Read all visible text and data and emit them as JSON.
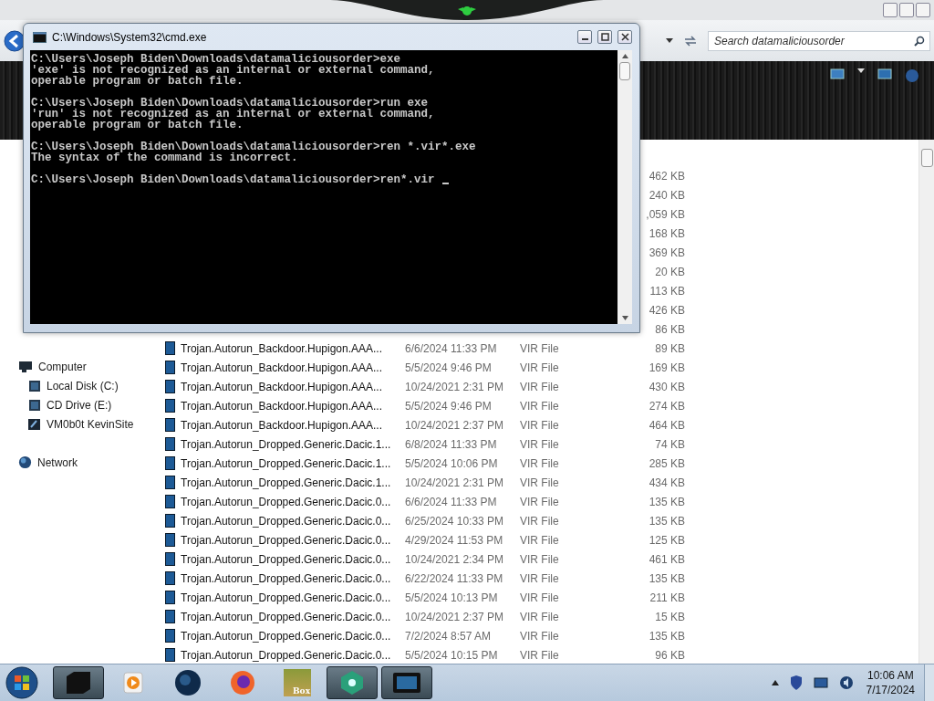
{
  "explorer": {
    "search": {
      "placeholder": "Search datamaliciousorder"
    },
    "nav": [
      {
        "label": "Computer",
        "kind": "computer",
        "children": [
          {
            "label": "Local Disk (C:)",
            "kind": "disk"
          },
          {
            "label": "CD Drive (E:)",
            "kind": "disk"
          },
          {
            "label": "VM0b0t KevinSite",
            "kind": "share"
          }
        ]
      },
      {
        "label": "Network",
        "kind": "network"
      }
    ],
    "files": [
      {
        "size": "462 KB"
      },
      {
        "size": "240 KB"
      },
      {
        "size": ",059 KB"
      },
      {
        "size": "168 KB"
      },
      {
        "size": "369 KB"
      },
      {
        "size": "20 KB"
      },
      {
        "size": "113 KB"
      },
      {
        "size": "426 KB"
      },
      {
        "size": "86 KB"
      },
      {
        "name": "Trojan.Autorun_Backdoor.Hupigon.AAA...",
        "date": "6/6/2024 11:33 PM",
        "type": "VIR File",
        "size": "89 KB"
      },
      {
        "name": "Trojan.Autorun_Backdoor.Hupigon.AAA...",
        "date": "5/5/2024 9:46 PM",
        "type": "VIR File",
        "size": "169 KB"
      },
      {
        "name": "Trojan.Autorun_Backdoor.Hupigon.AAA...",
        "date": "10/24/2021 2:31 PM",
        "type": "VIR File",
        "size": "430 KB"
      },
      {
        "name": "Trojan.Autorun_Backdoor.Hupigon.AAA...",
        "date": "5/5/2024 9:46 PM",
        "type": "VIR File",
        "size": "274 KB"
      },
      {
        "name": "Trojan.Autorun_Backdoor.Hupigon.AAA...",
        "date": "10/24/2021 2:37 PM",
        "type": "VIR File",
        "size": "464 KB"
      },
      {
        "name": "Trojan.Autorun_Dropped.Generic.Dacic.1...",
        "date": "6/8/2024 11:33 PM",
        "type": "VIR File",
        "size": "74 KB"
      },
      {
        "name": "Trojan.Autorun_Dropped.Generic.Dacic.1...",
        "date": "5/5/2024 10:06 PM",
        "type": "VIR File",
        "size": "285 KB"
      },
      {
        "name": "Trojan.Autorun_Dropped.Generic.Dacic.1...",
        "date": "10/24/2021 2:31 PM",
        "type": "VIR File",
        "size": "434 KB"
      },
      {
        "name": "Trojan.Autorun_Dropped.Generic.Dacic.0...",
        "date": "6/6/2024 11:33 PM",
        "type": "VIR File",
        "size": "135 KB"
      },
      {
        "name": "Trojan.Autorun_Dropped.Generic.Dacic.0...",
        "date": "6/25/2024 10:33 PM",
        "type": "VIR File",
        "size": "135 KB"
      },
      {
        "name": "Trojan.Autorun_Dropped.Generic.Dacic.0...",
        "date": "4/29/2024 11:53 PM",
        "type": "VIR File",
        "size": "125 KB"
      },
      {
        "name": "Trojan.Autorun_Dropped.Generic.Dacic.0...",
        "date": "10/24/2021 2:34 PM",
        "type": "VIR File",
        "size": "461 KB"
      },
      {
        "name": "Trojan.Autorun_Dropped.Generic.Dacic.0...",
        "date": "6/22/2024 11:33 PM",
        "type": "VIR File",
        "size": "135 KB"
      },
      {
        "name": "Trojan.Autorun_Dropped.Generic.Dacic.0...",
        "date": "5/5/2024 10:13 PM",
        "type": "VIR File",
        "size": "211 KB"
      },
      {
        "name": "Trojan.Autorun_Dropped.Generic.Dacic.0...",
        "date": "10/24/2021 2:37 PM",
        "type": "VIR File",
        "size": "15 KB"
      },
      {
        "name": "Trojan.Autorun_Dropped.Generic.Dacic.0...",
        "date": "7/2/2024 8:57 AM",
        "type": "VIR File",
        "size": "135 KB"
      },
      {
        "name": "Trojan.Autorun_Dropped.Generic.Dacic.0...",
        "date": "5/5/2024 10:15 PM",
        "type": "VIR File",
        "size": "96 KB"
      }
    ]
  },
  "console": {
    "title": "C:\\Windows\\System32\\cmd.exe",
    "blocks": [
      [
        "C:\\Users\\Joseph Biden\\Downloads\\datamaliciousorder>exe",
        "'exe' is not recognized as an internal or external command,",
        "operable program or batch file."
      ],
      [
        "C:\\Users\\Joseph Biden\\Downloads\\datamaliciousorder>run exe",
        "'run' is not recognized as an internal or external command,",
        "operable program or batch file."
      ],
      [
        "C:\\Users\\Joseph Biden\\Downloads\\datamaliciousorder>ren *.vir*.exe",
        "The syntax of the command is incorrect."
      ],
      [
        "C:\\Users\\Joseph Biden\\Downloads\\datamaliciousorder>ren*.vir"
      ]
    ]
  },
  "taskbar": {
    "apps": [
      {
        "kind": "box",
        "open": true
      },
      {
        "kind": "media",
        "open": false
      },
      {
        "kind": "globe",
        "open": false
      },
      {
        "kind": "firefox",
        "open": false
      },
      {
        "kind": "game",
        "open": false,
        "label": "Box"
      },
      {
        "kind": "green",
        "open": true
      },
      {
        "kind": "screen",
        "open": true
      }
    ],
    "clock": {
      "time": "10:06 AM",
      "date": "7/17/2024"
    }
  }
}
